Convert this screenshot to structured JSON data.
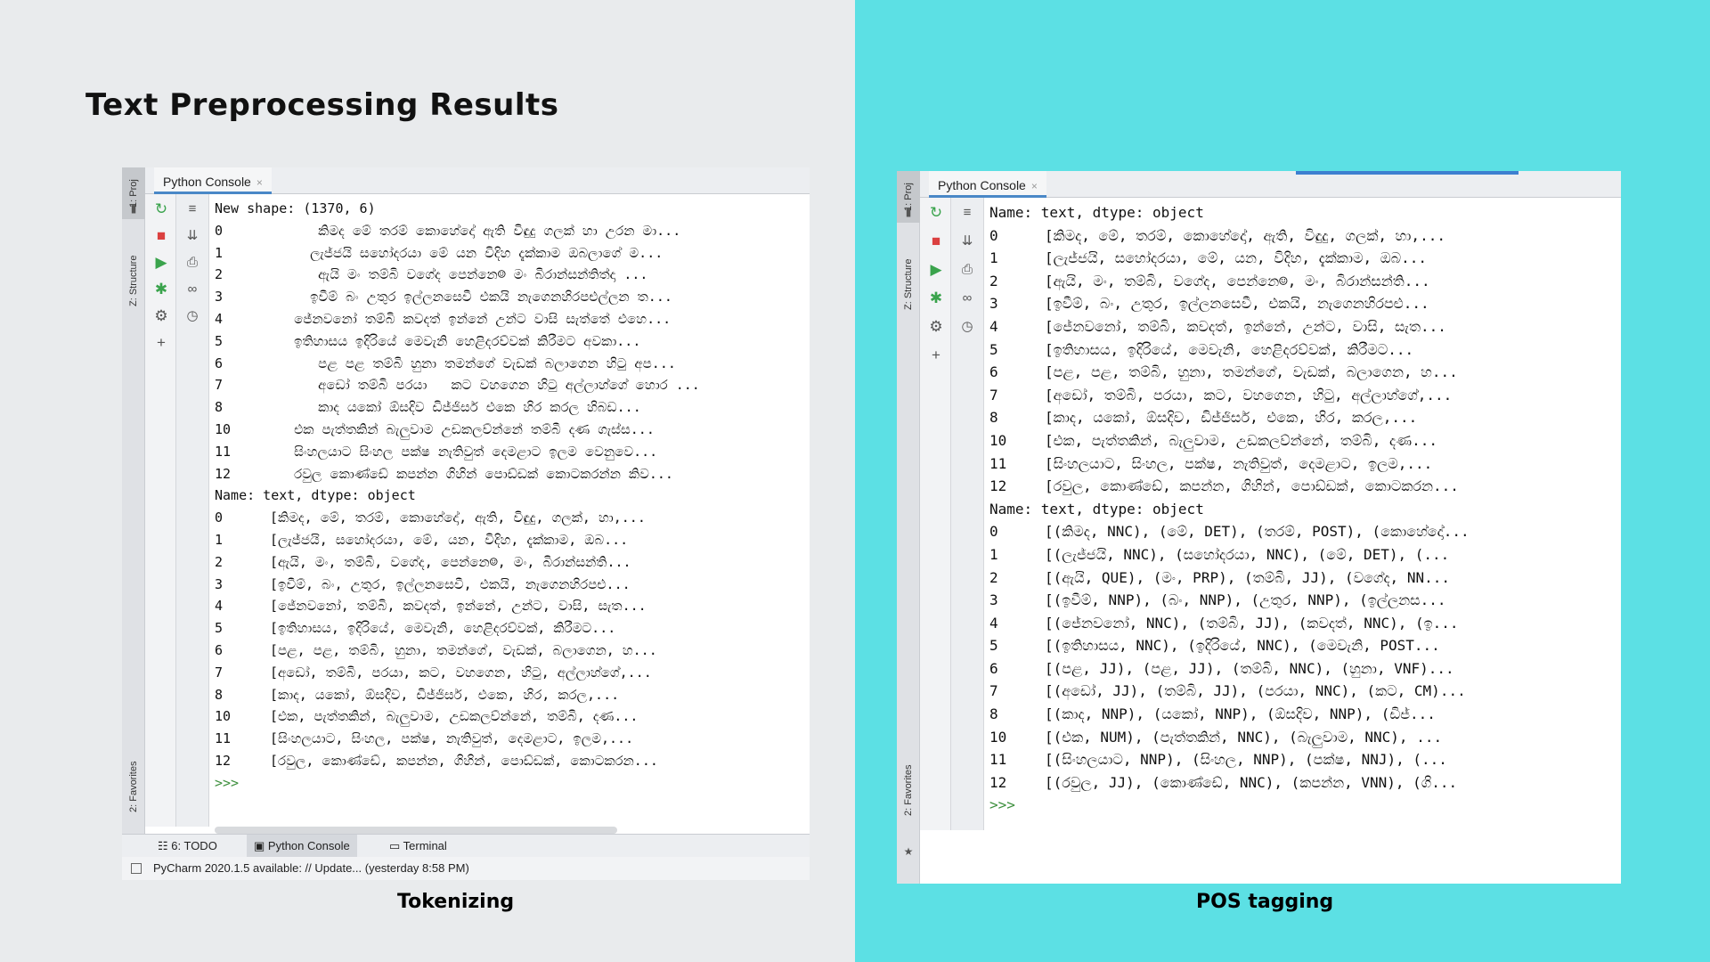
{
  "slide": {
    "title": "Text Preprocessing Results",
    "caption_left": "Tokenizing",
    "caption_right": "POS tagging"
  },
  "ide_left": {
    "tab_label": "Python Console",
    "tab_close": "×",
    "side_project": "1: Proj",
    "side_structure": "Z: Structure",
    "side_favorites": "2: Favorites",
    "header_line": "New shape: (1370, 6)",
    "raw_rows": [
      {
        "idx": "0",
        "text": "      කිමද මේ තරම් කොහේදෝ ඇති විඳුදු ගලක් හා උරන මා..."
      },
      {
        "idx": "1",
        "text": "     ලැජ්ජයි සහෝදරයා මේ යන විදිහ දැක්කාම ඔබලාගේ ම..."
      },
      {
        "idx": "2",
        "text": "      ඇයි මං තම්බි වගේද පෙන්නෙ☺ මං බිරාන්සන්තිත්දා ..."
      },
      {
        "idx": "3",
        "text": "     ඉවීම් බං උතුර ඉල්ලනසෙවී එකයි නැගෙනහිරපළුල්ලන ත..."
      },
      {
        "idx": "4",
        "text": "   ජේනවනෝ තම්බි කවදත් ඉන්නේ උන්ට වාසි සැත්තේ එහෙ..."
      },
      {
        "idx": "5",
        "text": "   ඉතිහාසය ඉදිරියේ මෙවැනි හෙළිදරව්වක් කිරීමට අවකා..."
      },
      {
        "idx": "6",
        "text": "      පළ පළ තම්බි හුනා තමන්ගේ වැඩක් බලාගෙන හිටු අප..."
      },
      {
        "idx": "7",
        "text": "      අඩෝ තම්බි පරයා   කට වහගෙන හිටු අල්ලාහ්ගේ හොර ..."
      },
      {
        "idx": "8",
        "text": "      කාද යකෝ ඕසදිව ඩිජ්ජිසර් එකෙ හිර කරල හිබඩ..."
      },
      {
        "idx": "10",
        "text": "   එක පැත්තකින් බැලුවාම උඩකලව්න්නේ තම්බී දණ ගැස්ස..."
      },
      {
        "idx": "11",
        "text": "   සිංහලයාට සිංහල පක්ෂ නැතිවුත් දෙමළාට ඉලම වෙනුවෙ..."
      },
      {
        "idx": "12",
        "text": "   රවුල කොණ්ඩේ කපන්න ගිහින් පොඩ්ඩක් කොටකරන්න කිව..."
      }
    ],
    "name_line": "Name: text, dtype: object",
    "token_rows": [
      {
        "idx": "0",
        "text": "[කිමද, මේ, තරම්, කොහේදෝ, ඇති, විඳුදු, ගලක්, හා,..."
      },
      {
        "idx": "1",
        "text": "[ලැජ්ජයි, සහෝදරයා, මේ, යන, විදිහ, දැක්කාම, ඔබ..."
      },
      {
        "idx": "2",
        "text": "[ඇයි, මං, තම්බි, වගේද, පෙන්නෙ☺, මං, බිරාන්සන්ති..."
      },
      {
        "idx": "3",
        "text": "[ඉවීම්, බං, උතුර, ඉල්ලනසෙවී, එකයි, නැගෙනහිරපළු..."
      },
      {
        "idx": "4",
        "text": "[ජේනවනෝ, තම්බි, කවදත්, ඉන්නේ, උන්ට, වාසි, සැත..."
      },
      {
        "idx": "5",
        "text": "[ඉතිහාසය, ඉදිරියේ, මෙවැනි, හෙළිදරව්වක්, කිරීමට..."
      },
      {
        "idx": "6",
        "text": "[පළ, පළ, තම්බි, හුනා, තමන්ගේ, වැඩක්, බලාගෙන, හ..."
      },
      {
        "idx": "7",
        "text": "[අඩෝ, තම්බි, පරයා, කට, වහගෙන, හිටු, අල්ලාහ්ගේ,..."
      },
      {
        "idx": "8",
        "text": "[කාද, යකෝ, ඕසදිව, ඩිජ්ජිසර්, එකෙ, හිර, කරල,..."
      },
      {
        "idx": "10",
        "text": "[එක, පැත්තකින්, බැලුවාම, උඩකලව්න්නේ, තම්බි, දණ..."
      },
      {
        "idx": "11",
        "text": "[සිංහලයාට, සිංහල, පක්ෂ, නැතිවුත්, දෙමළාට, ඉලම,..."
      },
      {
        "idx": "12",
        "text": "[රවුල, කොණ්ඩේ, කපන්න, ගිහින්, පොඩ්ඩක්, කොටකරන..."
      }
    ],
    "prompt": ">>>",
    "bottom_tabs": {
      "todo": "☷ 6: TODO",
      "console": "Python Console",
      "terminal": "Terminal"
    },
    "status": "PyCharm 2020.1.5 available: // Update... (yesterday 8:58 PM)"
  },
  "ide_right": {
    "tab_label": "Python Console",
    "tab_close": "×",
    "side_project": "1: Proj",
    "side_structure": "Z: Structure",
    "side_favorites": "2: Favorites",
    "name_line_1": "Name: text, dtype: object",
    "token_rows": [
      {
        "idx": "0",
        "text": "[කිමද, මේ, තරම්, කොහේදෝ, ඇති, විඳුදු, ගලක්, හා,..."
      },
      {
        "idx": "1",
        "text": "[ලැජ්ජයි, සහෝදරයා, මේ, යන, විදිහ, දැක්කාම, ඔබ..."
      },
      {
        "idx": "2",
        "text": "[ඇයි, මං, තම්බි, වගේද, පෙන්නෙ☺, මං, බිරාන්සන්ති..."
      },
      {
        "idx": "3",
        "text": "[ඉවීම්, බං, උතුර, ඉල්ලනසෙවී, එකයි, නැගෙනහිරපළු..."
      },
      {
        "idx": "4",
        "text": "[ජේනවනෝ, තම්බි, කවදත්, ඉන්නේ, උන්ට, වාසි, සැත..."
      },
      {
        "idx": "5",
        "text": "[ඉතිහාසය, ඉදිරියේ, මෙවැනි, හෙළිදරව්වක්, කිරීමට..."
      },
      {
        "idx": "6",
        "text": "[පළ, පළ, තම්බි, හුනා, තමන්ගේ, වැඩක්, බලාගෙන, හ..."
      },
      {
        "idx": "7",
        "text": "[අඩෝ, තම්බි, පරයා, කට, වහගෙන, හිටු, අල්ලාහ්ගේ,..."
      },
      {
        "idx": "8",
        "text": "[කාද, යකෝ, ඕසදිව, ඩිජ්ජිසර්, එකෙ, හිර, කරල,..."
      },
      {
        "idx": "10",
        "text": "[එක, පැත්තකින්, බැලුවාම, උඩකලව්න්නේ, තම්බි, දණ..."
      },
      {
        "idx": "11",
        "text": "[සිංහලයාට, සිංහල, පක්ෂ, නැතිවුත්, දෙමළාට, ඉලම,..."
      },
      {
        "idx": "12",
        "text": "[රවුල, කොණ්ඩේ, කපන්න, ගිහින්, පොඩ්ඩක්, කොටකරන..."
      }
    ],
    "name_line_2": "Name: text, dtype: object",
    "pos_rows": [
      {
        "idx": "0",
        "text": "[(කිමද, NNC), (මේ, DET), (තරම්, POST), (කොහේදෝ..."
      },
      {
        "idx": "1",
        "text": "[(ලැජ්ජයි, NNC), (සහෝදරයා, NNC), (මේ, DET), (..."
      },
      {
        "idx": "2",
        "text": "[(ඇයි, QUE), (මං, PRP), (තම්බි, JJ), (වගේද, NN..."
      },
      {
        "idx": "3",
        "text": "[(ඉවීම්, NNP), (බං, NNP), (උතුර, NNP), (ඉල්ලනස..."
      },
      {
        "idx": "4",
        "text": "[(ජේනවනෝ, NNC), (තම්බි, JJ), (කවදත්, NNC), (ඉ..."
      },
      {
        "idx": "5",
        "text": "[(ඉතිහාසය, NNC), (ඉදිරියේ, NNC), (මෙවැනි, POST..."
      },
      {
        "idx": "6",
        "text": "[(පළ, JJ), (පළ, JJ), (තම්බි, NNC), (හුනා, VNF)..."
      },
      {
        "idx": "7",
        "text": "[(අඩෝ, JJ), (තම්බි, JJ), (පරයා, NNC), (කට, CM)..."
      },
      {
        "idx": "8",
        "text": "[(කාද, NNP), (යකෝ, NNP), (ඕසදිව, NNP), (ඩිජ්..."
      },
      {
        "idx": "10",
        "text": "[(එක, NUM), (පැත්තකින්, NNC), (බැලුවාම, NNC), ..."
      },
      {
        "idx": "11",
        "text": "[(සිංහලයාට, NNP), (සිංහල, NNP), (පක්ෂ, NNJ), (..."
      },
      {
        "idx": "12",
        "text": "[(රවුල, JJ), (කොණ්ඩේ, NNC), (කපන්න, VNN), (ගි..."
      }
    ],
    "prompt": ">>>"
  },
  "icons": [
    "rerun-icon",
    "stop-icon",
    "run-icon",
    "debug-icon",
    "settings-icon",
    "add-icon",
    "soft-wrap-icon",
    "scroll-end-icon",
    "print-icon",
    "show-variables-icon",
    "history-icon",
    "star-icon",
    "folder-icon",
    "structure-icon"
  ]
}
